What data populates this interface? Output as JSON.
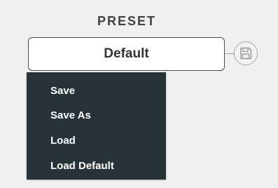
{
  "preset": {
    "title": "PRESET",
    "current_value": "Default",
    "save_icon": "floppy-disk-icon"
  },
  "menu": {
    "items": [
      {
        "label": "Save"
      },
      {
        "label": "Save As"
      },
      {
        "label": "Load"
      },
      {
        "label": "Load Default"
      }
    ]
  },
  "colors": {
    "menu_background": "#283239",
    "menu_text": "#ffffff",
    "panel_background": "#f0f0f0",
    "box_border": "#4a4d50",
    "title_text": "#404346"
  }
}
